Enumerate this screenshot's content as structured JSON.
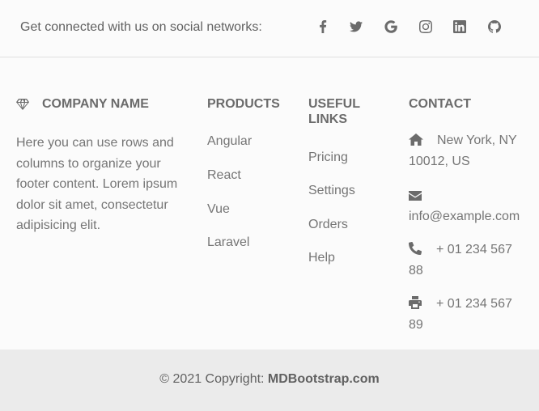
{
  "social": {
    "text": "Get connected with us on social networks:",
    "icons": [
      "facebook-icon",
      "twitter-icon",
      "google-icon",
      "instagram-icon",
      "linkedin-icon",
      "github-icon"
    ]
  },
  "company": {
    "icon": "gem-icon",
    "title": "COMPANY NAME",
    "text": "Here you can use rows and columns to organize your footer content. Lorem ipsum dolor sit amet, consectetur adipisicing elit."
  },
  "products": {
    "title": "PRODUCTS",
    "items": [
      "Angular",
      "React",
      "Vue",
      "Laravel"
    ]
  },
  "useful_links": {
    "title_line1": "USEFUL",
    "title_line2": "LINKS",
    "items": [
      "Pricing",
      "Settings",
      "Orders",
      "Help"
    ]
  },
  "contact": {
    "title": "CONTACT",
    "address_line1": "New York, NY",
    "address_line2": "10012, US",
    "email": "info@example.com",
    "phone_line1": "+ 01 234 567",
    "phone_line2": "88",
    "fax_line1": "+ 01 234 567",
    "fax_line2": "89"
  },
  "copyright": {
    "prefix": "© 2021 Copyright: ",
    "link": "MDBootstrap.com"
  }
}
